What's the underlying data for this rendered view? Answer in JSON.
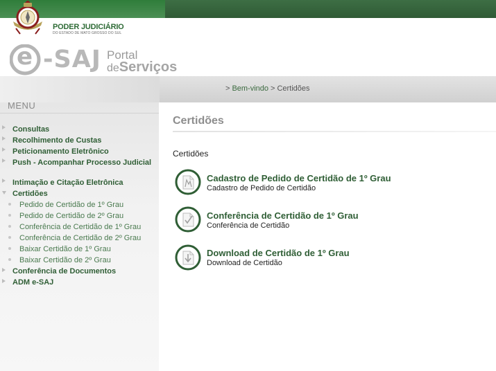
{
  "header": {
    "org_title": "PODER JUDICIÁRIO",
    "org_subtitle": "DO ESTADO DE MATO GROSSO DO SUL",
    "logo_main": "-SAJ",
    "logo_e": "e",
    "portal_line1": "Portal",
    "portal_de": "de",
    "portal_servicos": "Serviços"
  },
  "breadcrumb": {
    "items": [
      "Bem-vindo",
      "Certidões"
    ],
    "separator": ">"
  },
  "menu": {
    "title": "MENU",
    "items": [
      {
        "label": "Consultas"
      },
      {
        "label": "Recolhimento de Custas"
      },
      {
        "label": "Peticionamento Eletrônico"
      },
      {
        "label": "Push - Acompanhar Processo Judicial"
      },
      {
        "label": "Intimação e Citação Eletrônica"
      },
      {
        "label": "Certidões"
      },
      {
        "label": "Conferência de Documentos"
      },
      {
        "label": "ADM e-SAJ"
      }
    ],
    "certidoes_sub": [
      {
        "label": "Pedido de Certidão de 1º Grau"
      },
      {
        "label": "Pedido de Certidão de 2º Grau"
      },
      {
        "label": "Conferência de Certidão de 1º Grau"
      },
      {
        "label": "Conferência de Certidão de 2º Grau"
      },
      {
        "label": "Baixar Certidão de 1º Grau"
      },
      {
        "label": "Baixar Certidão de 2º Grau"
      }
    ]
  },
  "main": {
    "title": "Certidões",
    "section_label": "Certidões",
    "cards": [
      {
        "title": "Cadastro de Pedido de Certidão de 1º Grau",
        "desc": "Cadastro de Pedido de Certidão",
        "icon": "document-request-icon"
      },
      {
        "title": "Conferência de Certidão de 1º Grau",
        "desc": "Conferência de Certidão",
        "icon": "document-check-icon"
      },
      {
        "title": "Download de Certidão de 1º Grau",
        "desc": "Download de Certidão",
        "icon": "document-download-icon"
      }
    ]
  },
  "colors": {
    "brand_green": "#2f5e35",
    "link_green": "#4a7a4f",
    "gray_text": "#8d8d8d"
  }
}
